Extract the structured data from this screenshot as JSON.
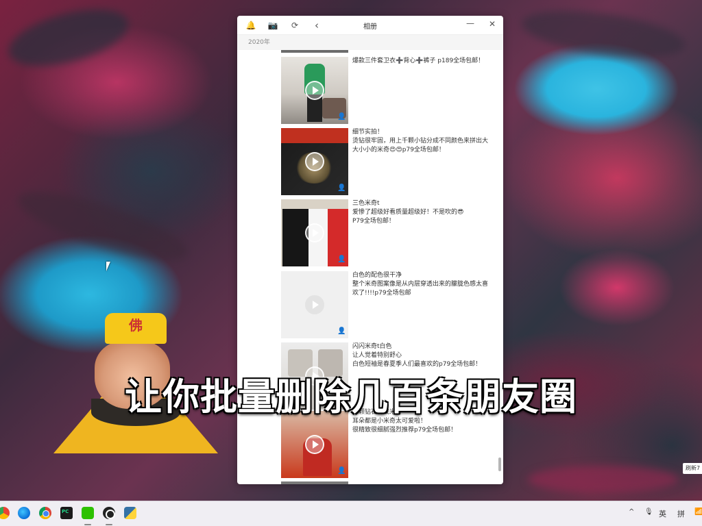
{
  "window": {
    "title": "相册",
    "year": "2020年",
    "icons": [
      "bell-icon",
      "camera-icon",
      "refresh-icon",
      "back-icon",
      "minimize-icon",
      "close-icon"
    ]
  },
  "posts": [
    {
      "text": "爆款三件套卫衣➕背心➕裤子 p189全场包邮！"
    },
    {
      "text": "细节实拍！\n烫钻很牢固，用上千颗小钻分成不同颜色来拼出大大小小的米奇😍😍p79全场包邮！"
    },
    {
      "text": "三色米奇t\n爱惨了超级好看质量超级好！不是吹的😎\nP79全场包邮！"
    },
    {
      "text": "白色的配色很干净\n整个米奇图案像是从内层穿透出来的朦胧色感太喜欢了!!!!p79全场包邮"
    },
    {
      "text": "闪闪米奇t白色\n让人觉着特别舒心\n白色短袖是春夏季人们最喜欢的p79全场包邮！"
    },
    {
      "text": "颗颗钻石合成米奇～\n耳朵都是小米奇太可爱啦！\n很精致很细腻强烈推荐p79全场包邮！"
    }
  ],
  "overlay": {
    "caption": "让你批量删除几百条朋友圈"
  },
  "side_pill": "刷新7",
  "sticker": {
    "hat_text": "佛"
  },
  "taskbar": {
    "apps": [
      "chrome-icon",
      "edge-icon",
      "chrome-icon",
      "pycharm-icon",
      "wechat-icon",
      "obs-icon",
      "python-icon"
    ],
    "tray": {
      "chevron": "^",
      "mic": "🎙",
      "ime_lang": "英",
      "ime_mode": "拼",
      "wifi": "📶"
    }
  }
}
